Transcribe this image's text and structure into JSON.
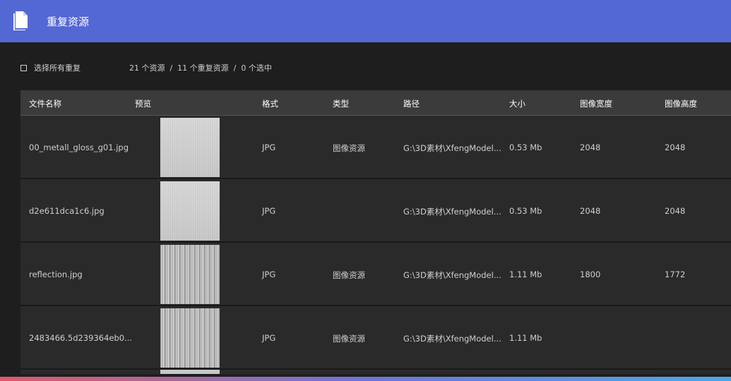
{
  "window": {
    "title": "重复资源",
    "icon": "document-icon"
  },
  "toolbar": {
    "select_all_label": "选择所有重复",
    "summary": "21 个资源  /  11 个重复资源  /  0 个选中"
  },
  "table": {
    "columns": [
      "文件名称",
      "预览",
      "格式",
      "类型",
      "路径",
      "大小",
      "图像宽度",
      "图像高度"
    ],
    "rows": [
      {
        "name": "00_metall_gloss_g01.jpg",
        "format": "JPG",
        "type": "图像资源",
        "path": "G:\\3D素材\\XfengModel...",
        "size": "0.53 Mb",
        "width": "2048",
        "height": "2048",
        "preview": "gloss"
      },
      {
        "name": "d2e611dca1c6.jpg",
        "format": "JPG",
        "type": "",
        "path": "G:\\3D素材\\XfengModel...",
        "size": "0.53 Mb",
        "width": "2048",
        "height": "2048",
        "preview": "gloss"
      },
      {
        "name": "reflection.jpg",
        "format": "JPG",
        "type": "图像资源",
        "path": "G:\\3D素材\\XfengModel...",
        "size": "1.11 Mb",
        "width": "1800",
        "height": "1772",
        "preview": "brushed"
      },
      {
        "name": "2483466.5d239364eb0...",
        "format": "JPG",
        "type": "图像资源",
        "path": "G:\\3D素材\\XfengModel...",
        "size": "1.11 Mb",
        "width": "",
        "height": "",
        "preview": "brushed"
      }
    ]
  },
  "colors": {
    "titlebar": "#5468d4",
    "background": "#1e1e1e",
    "header": "#3b3b3b",
    "row": "#2a2a2a"
  }
}
